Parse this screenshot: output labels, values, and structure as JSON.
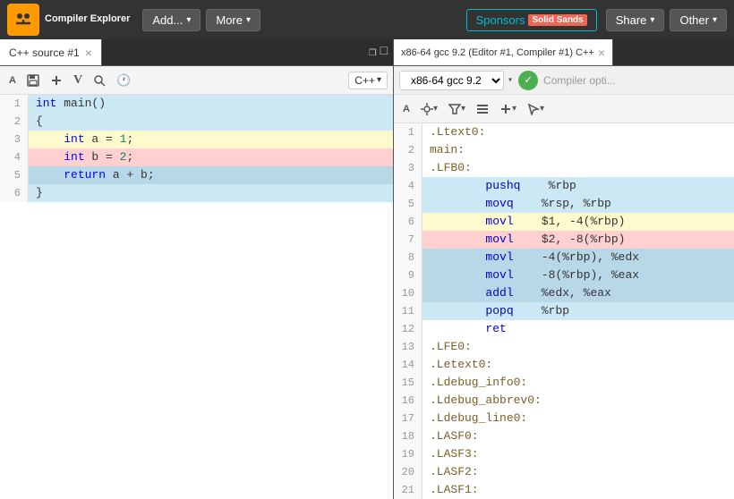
{
  "app": {
    "name": "Compiler Explorer",
    "logo_char": "≡"
  },
  "navbar": {
    "add_label": "Add...",
    "more_label": "More",
    "sponsors_label": "Sponsors",
    "solid_sands_label": "Solid Sands",
    "share_label": "Share",
    "other_label": "Other"
  },
  "left_panel": {
    "tab_label": "C++ source #1",
    "lang": "C++",
    "code_lines": [
      {
        "num": "1",
        "text": "int main()",
        "highlight": "blue"
      },
      {
        "num": "2",
        "text": "{",
        "highlight": "blue"
      },
      {
        "num": "3",
        "text": "    int a = 1;",
        "highlight": "yellow"
      },
      {
        "num": "4",
        "text": "    int b = 2;",
        "highlight": "pink"
      },
      {
        "num": "5",
        "text": "    return a + b;",
        "highlight": "blue-dark"
      },
      {
        "num": "6",
        "text": "}",
        "highlight": "blue"
      }
    ]
  },
  "right_panel": {
    "tab_label": "x86-64 gcc 9.2 (Editor #1, Compiler #1) C++",
    "compiler_name": "x86-64 gcc 9.2",
    "compiler_options_placeholder": "Compiler opti...",
    "asm_lines": [
      {
        "num": "1",
        "text": ".Ltext0:",
        "type": "label",
        "highlight": ""
      },
      {
        "num": "2",
        "text": "main:",
        "type": "label",
        "highlight": ""
      },
      {
        "num": "3",
        "text": ".LFB0:",
        "type": "label",
        "highlight": ""
      },
      {
        "num": "4",
        "text": "        pushq   %rbp",
        "type": "instr",
        "highlight": "blue"
      },
      {
        "num": "5",
        "text": "        movq    %rsp, %rbp",
        "type": "instr",
        "highlight": "blue"
      },
      {
        "num": "6",
        "text": "        movl    $1, -4(%rbp)",
        "type": "instr",
        "highlight": "yellow"
      },
      {
        "num": "7",
        "text": "        movl    $2, -8(%rbp)",
        "type": "instr",
        "highlight": "pink"
      },
      {
        "num": "8",
        "text": "        movl    -4(%rbp), %edx",
        "type": "instr",
        "highlight": "blue-dark"
      },
      {
        "num": "9",
        "text": "        movl    -8(%rbp), %eax",
        "type": "instr",
        "highlight": "blue-dark"
      },
      {
        "num": "10",
        "text": "        addl    %edx, %eax",
        "type": "instr",
        "highlight": "blue-dark"
      },
      {
        "num": "11",
        "text": "        popq    %rbp",
        "type": "instr",
        "highlight": "blue"
      },
      {
        "num": "12",
        "text": "        ret",
        "type": "instr",
        "highlight": ""
      },
      {
        "num": "13",
        "text": ".LFE0:",
        "type": "label",
        "highlight": ""
      },
      {
        "num": "14",
        "text": ".Letext0:",
        "type": "label",
        "highlight": ""
      },
      {
        "num": "15",
        "text": ".Ldebug_info0:",
        "type": "label",
        "highlight": ""
      },
      {
        "num": "16",
        "text": ".Ldebug_abbrev0:",
        "type": "label",
        "highlight": ""
      },
      {
        "num": "17",
        "text": ".Ldebug_line0:",
        "type": "label",
        "highlight": ""
      },
      {
        "num": "18",
        "text": ".LASF0:",
        "type": "label",
        "highlight": ""
      },
      {
        "num": "19",
        "text": ".LASF3:",
        "type": "label",
        "highlight": ""
      },
      {
        "num": "20",
        "text": ".LASF2:",
        "type": "label",
        "highlight": ""
      },
      {
        "num": "21",
        "text": ".LASF1:",
        "type": "label",
        "highlight": ""
      }
    ]
  },
  "icons": {
    "font_decrease": "A",
    "font_increase": "A",
    "add": "+",
    "bold": "B",
    "search": "🔍",
    "clock": "🕐",
    "filter": "▼",
    "settings": "⚙",
    "columns": "☰",
    "chevron": "▾",
    "checkmark": "✓",
    "close": "×",
    "maximize": "□",
    "restore": "❐",
    "cursor": "↗"
  }
}
